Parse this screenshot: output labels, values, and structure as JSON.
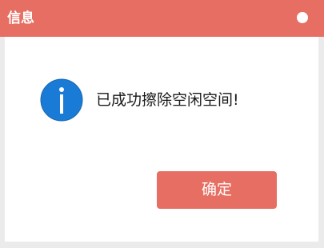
{
  "window": {
    "title": "信息",
    "close_control": "close-dot-icon"
  },
  "dialog": {
    "icon": "info-icon",
    "message": "已成功擦除空闲空间!",
    "ok_label": "确定"
  },
  "colors": {
    "titlebar": "#e66e62",
    "button": "#e66e62",
    "icon": "#1a7bd6",
    "background": "#ebebeb",
    "body": "#ffffff"
  }
}
